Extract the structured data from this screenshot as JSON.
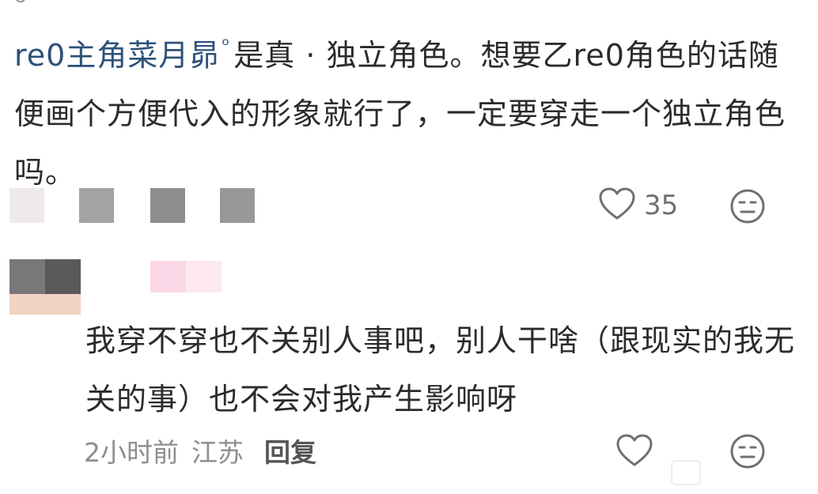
{
  "comment_1": {
    "mention": "re0主角菜月昴",
    "text_after_mention": "是真 · 独立角色。想要乙re0角色的话随便画个方便代入的形象就行了，一定要穿走一个独立角色吗。",
    "likes": "35",
    "icons": {
      "like": "heart-outline-icon",
      "emoji": "neutral-face-icon",
      "search": "search-icon"
    }
  },
  "reply_1": {
    "text": "我穿不穿也不关别人事吧，别人干啥（跟现实的我无关的事）也不会对我产生影响呀",
    "time": "2小时前",
    "region": "江苏",
    "reply_label": "回复",
    "icons": {
      "like": "heart-outline-icon",
      "emoji": "neutral-face-icon"
    }
  },
  "colors": {
    "text": "#2b2b2b",
    "mention": "#2d5278",
    "meta": "#8e8e8e",
    "icon": "#707070"
  }
}
